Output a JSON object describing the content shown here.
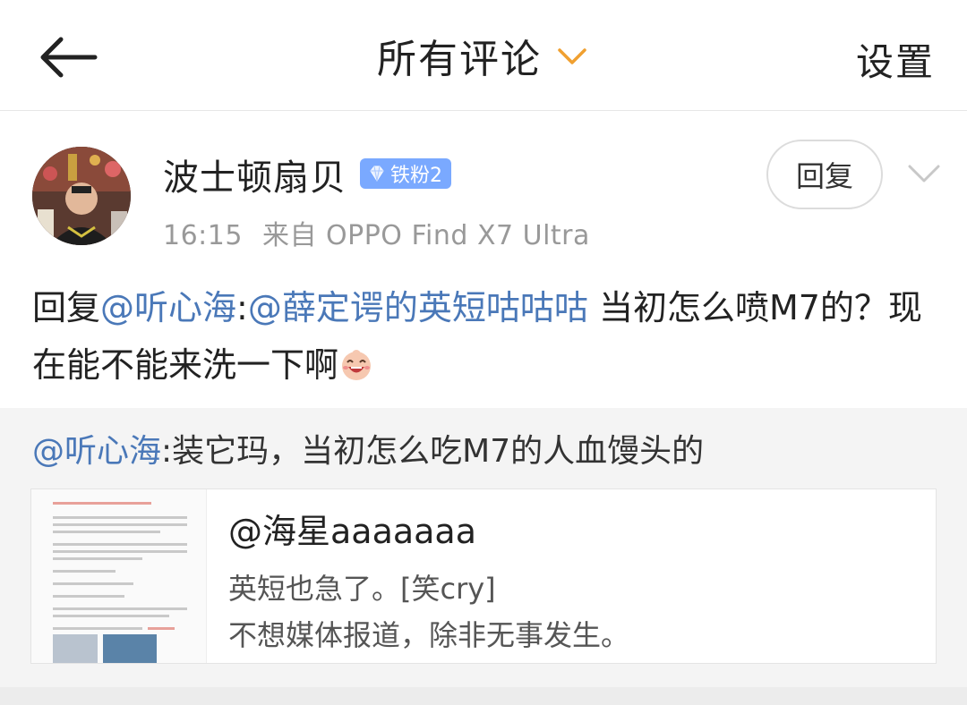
{
  "header": {
    "title": "所有评论",
    "settings_label": "设置"
  },
  "comment": {
    "username": "波士顿扇贝",
    "fan_badge": "铁粉2",
    "time": "16:15",
    "source": "来自 OPPO Find X7 Ultra",
    "reply_label": "回复",
    "body": {
      "prefix": "回复",
      "mention1": "@听心海",
      "colon": ":",
      "mention2": "@薛定谔的英短咕咕咕",
      "text": " 当初怎么喷M7的？现在能不能来洗一下啊"
    }
  },
  "quote": {
    "mention": "@听心海",
    "text": ":装它玛，当初怎么吃M7的人血馒头的",
    "card": {
      "title": "@海星aaaaaaa",
      "line1": "英短也急了。[笑cry]",
      "line2": "不想媒体报道，除非无事发生。"
    }
  },
  "colors": {
    "link": "#4a78b8",
    "accent_orange": "#f0a030",
    "badge_blue": "#7aa9ff",
    "meta_gray": "#999999"
  },
  "icons": {
    "back": "back-arrow-icon",
    "title_dropdown": "chevron-down-icon",
    "more": "chevron-down-icon",
    "badge": "diamond-icon",
    "emoji": "laughing-emoji-icon"
  }
}
